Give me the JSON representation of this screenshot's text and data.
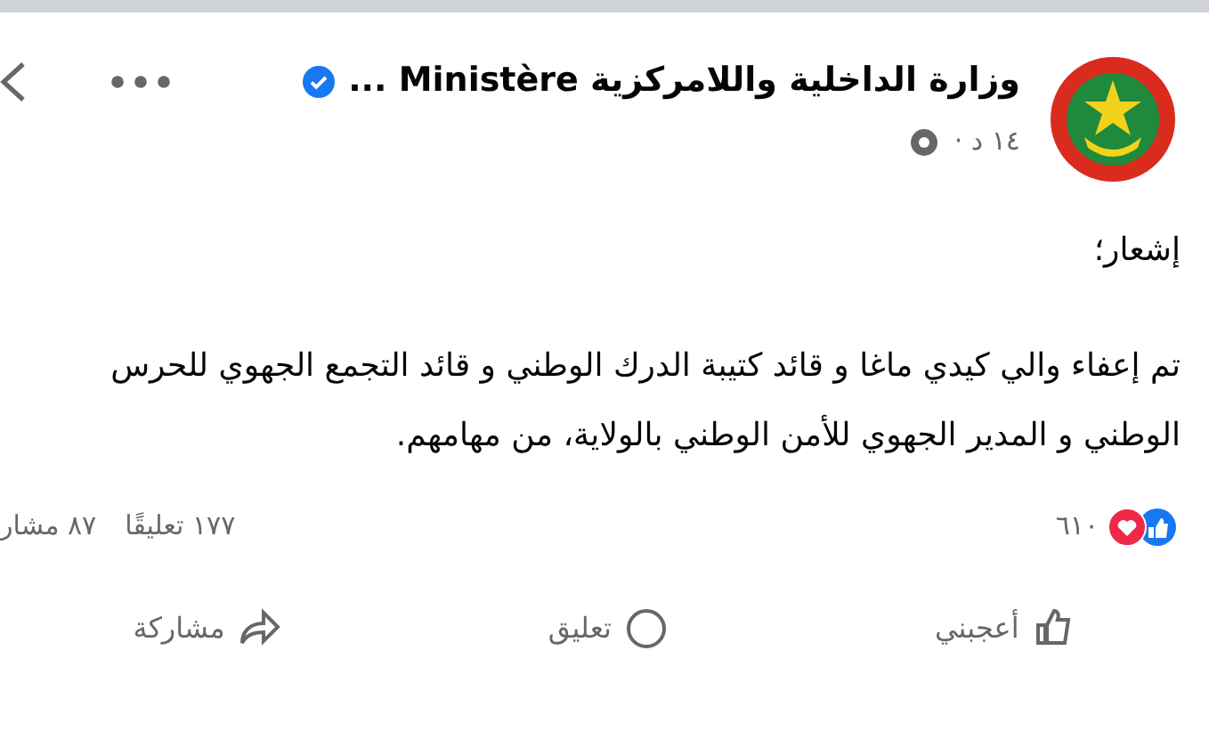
{
  "post": {
    "author": "وزارة الداخلية واللامركزية Ministère ...",
    "verified": true,
    "time": "١٤ د ·",
    "paragraphs": [
      "إشعار؛",
      "تم إعفاء والي كيدي ماغا و قائد كتيبة الدرك الوطني و قائد التجمع الجهوي للحرس الوطني و المدير الجهوي للأمن الوطني بالولاية، من مهامهم."
    ],
    "reactions_count": "٦١٠",
    "comments_count": "١٧٧ تعليقًا",
    "shares_count": "٨٧ مشار"
  },
  "actions": [
    {
      "kind": "like",
      "label": "أعجبني"
    },
    {
      "kind": "comment",
      "label": "تعليق"
    },
    {
      "kind": "share",
      "label": "مشاركة"
    }
  ]
}
